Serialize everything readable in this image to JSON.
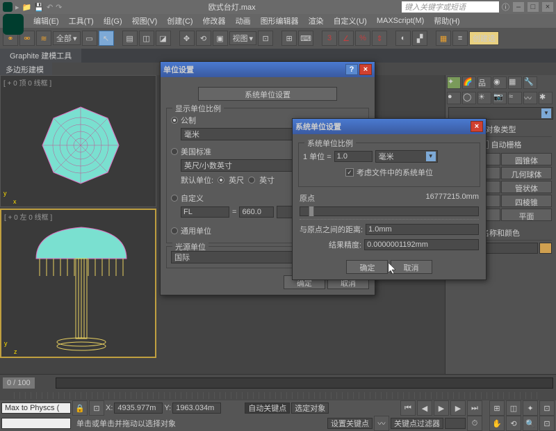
{
  "title": "欧式台灯.max",
  "search_placeholder": "键入关键字或短语",
  "menu": {
    "edit": "编辑(E)",
    "tools": "工具(T)",
    "group": "组(G)",
    "views": "视图(V)",
    "create": "创建(C)",
    "modifiers": "修改器",
    "anim": "动画",
    "graph": "图形编辑器",
    "render": "渲染",
    "custom": "自定义(U)",
    "maxscript": "MAXScript(M)",
    "help": "帮助(H)"
  },
  "toolbar": {
    "all": "全部",
    "view": "视图",
    "createsel": "创建选"
  },
  "graphite": "Graphite 建模工具",
  "poly_model": "多边形建模",
  "viewports": {
    "top": "[ + 0 顶 0 线框 ]",
    "left": "[ + 0 左 0 线框 ]"
  },
  "right_panel": {
    "obj_type": "对象类型",
    "auto_grid": "自动栅格",
    "cylinder": "圆锥体",
    "geosphere": "几何球体",
    "tube": "管状体",
    "pyramid": "四棱锥",
    "plane": "平面",
    "name_color": "名称和颜色"
  },
  "dlg1": {
    "title": "单位设置",
    "sys_btn": "系统单位设置",
    "display_legend": "显示单位比例",
    "metric": "公制",
    "metric_val": "毫米",
    "us": "美国标准",
    "us_val": "英尺/小数英寸",
    "default_unit": "默认单位:",
    "feet": "英尺",
    "inch": "英寸",
    "custom": "自定义",
    "custom_unit": "FL",
    "equals": "=",
    "custom_val": "660.0",
    "generic": "通用单位",
    "light_legend": "光源单位",
    "light_val": "国际",
    "ok": "确定",
    "cancel": "取消"
  },
  "dlg2": {
    "title": "系统单位设置",
    "legend": "系统单位比例",
    "one_unit": "1 单位 =",
    "val": "1.0",
    "unit": "毫米",
    "consider": "考虑文件中的系统单位",
    "origin": "原点",
    "origin_val": "16777215.0mm",
    "distance": "与原点之间的距离:",
    "distance_val": "1.0mm",
    "precision": "结果精度:",
    "precision_val": "0.0000001192mm",
    "ok": "确定",
    "cancel": "取消"
  },
  "timeline": {
    "range": "0 / 100"
  },
  "status": {
    "script": "Max to Physcs (",
    "x": "X:",
    "xval": "4935.977m",
    "y": "Y:",
    "yval": "1963.034m",
    "hint": "单击或单击并拖动以选择对象",
    "autokey": "自动关键点",
    "selobj": "选定对象",
    "setkey": "设置关键点",
    "keyfilter": "关键点过滤器"
  }
}
